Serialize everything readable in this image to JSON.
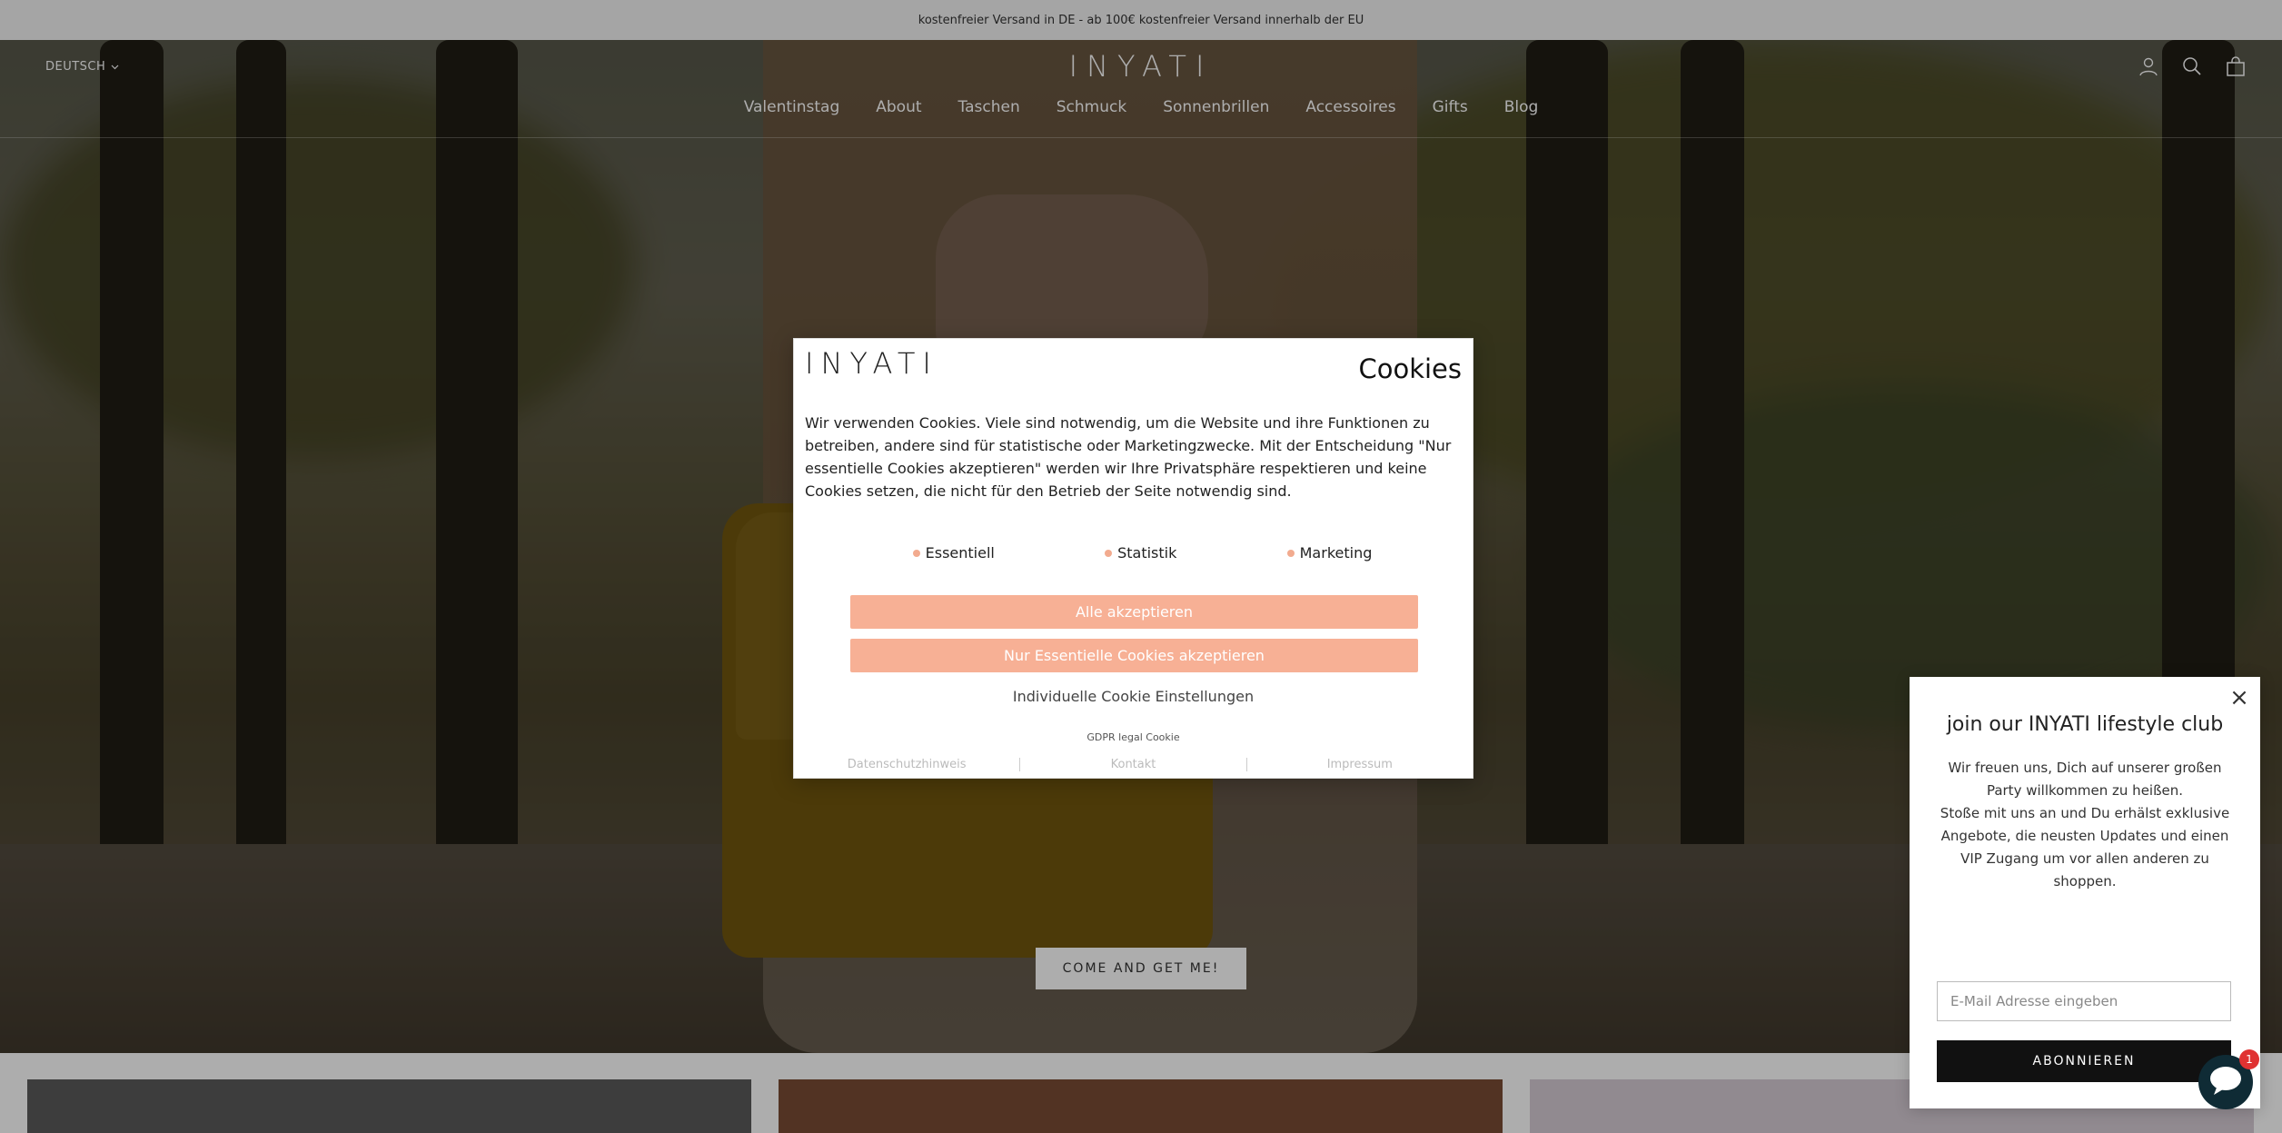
{
  "announcement": "kostenfreier Versand in DE - ab 100€ kostenfreier Versand innerhalb der EU",
  "header": {
    "language": "DEUTSCH",
    "logo_text": "INYATI",
    "icons": [
      "account-icon",
      "search-icon",
      "cart-icon"
    ],
    "nav": [
      "Valentinstag",
      "About",
      "Taschen",
      "Schmuck",
      "Sonnenbrillen",
      "Accessoires",
      "Gifts",
      "Blog"
    ]
  },
  "hero": {
    "cta_label": "COME AND GET ME!"
  },
  "cookie_modal": {
    "logo_text": "INYATI",
    "title": "Cookies",
    "body": "Wir verwenden Cookies. Viele sind notwendig, um die Website und ihre Funktionen zu betreiben, andere sind für statistische oder Marketingzwecke. Mit der Entscheidung \"Nur essentielle Cookies akzeptieren\" werden wir Ihre Privatsphäre respektieren und keine Cookies setzen, die nicht für den Betrieb der Seite notwendig sind.",
    "categories": [
      "Essentiell",
      "Statistik",
      "Marketing"
    ],
    "accept_all": "Alle akzeptieren",
    "accept_essential": "Nur Essentielle Cookies akzeptieren",
    "individual_settings": "Individuelle Cookie Einstellungen",
    "gdpr_label": "GDPR legal Cookie",
    "footer_links": [
      "Datenschutzhinweis",
      "Kontakt",
      "Impressum"
    ],
    "accent_color": "#f7b095"
  },
  "newsletter_popup": {
    "title": "join our INYATI lifestyle club",
    "text_1": "Wir freuen uns, Dich auf unserer großen Party willkommen zu heißen.",
    "text_2": "Stoße mit uns an und Du erhälst exklusive Angebote, die neusten Updates und einen VIP Zugang um vor allen anderen zu shoppen.",
    "email_placeholder": "E-Mail Adresse eingeben",
    "subscribe_label": "ABONNIEREN"
  },
  "chat": {
    "badge_count": "1"
  }
}
